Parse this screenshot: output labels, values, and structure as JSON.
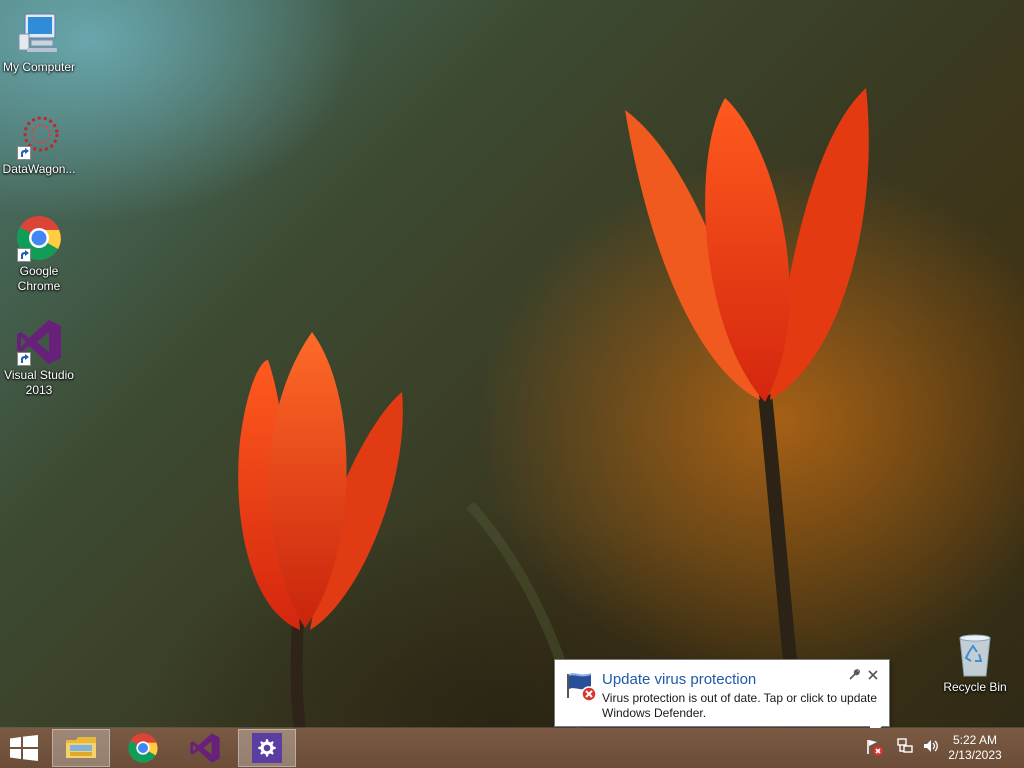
{
  "desktop": {
    "icons": [
      {
        "label": "My Computer"
      },
      {
        "label": "DataWagon..."
      },
      {
        "label": "Google Chrome"
      },
      {
        "label": "Visual Studio 2013"
      },
      {
        "label": "Recycle Bin"
      }
    ]
  },
  "notification": {
    "title": "Update virus protection",
    "message": "Virus protection is out of date. Tap or click to update Windows Defender.",
    "icon": "defender-flag-error-icon",
    "options_icon": "wrench-icon",
    "close_icon": "close-icon",
    "title_color": "#1f5aa8"
  },
  "taskbar": {
    "start_icon": "windows-logo-icon",
    "apps": [
      {
        "name": "File Explorer",
        "icon": "file-explorer-icon",
        "active": true
      },
      {
        "name": "Google Chrome",
        "icon": "chrome-icon",
        "active": false
      },
      {
        "name": "Visual Studio 2013",
        "icon": "visual-studio-icon",
        "active": false
      },
      {
        "name": "Settings",
        "icon": "gear-icon",
        "active": true
      }
    ],
    "tray": {
      "icons": [
        "action-center-error-icon",
        "network-icon",
        "volume-icon"
      ],
      "time": "5:22 AM",
      "date": "2/13/2023"
    }
  },
  "colors": {
    "taskbar": "#6f503b",
    "vs_purple": "#68217a",
    "settings_purple": "#5b3fa0"
  }
}
